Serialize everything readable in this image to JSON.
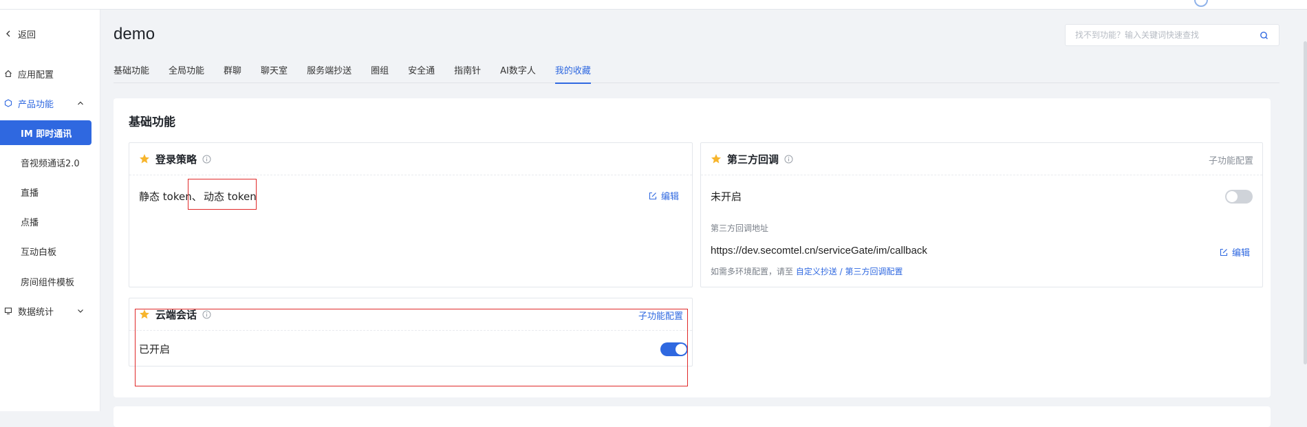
{
  "colors": {
    "primary": "#2f68e0",
    "star": "#f7b52c",
    "highlight": "#e02828"
  },
  "sidebar": {
    "back_label": "返回",
    "items": [
      {
        "label": "应用配置",
        "icon": "home-icon"
      },
      {
        "label": "产品功能",
        "icon": "hexagon-icon",
        "expanded": true
      },
      {
        "label": "数据统计",
        "icon": "monitor-icon",
        "expanded": false
      }
    ],
    "sub_items": [
      {
        "label": "IM 即时通讯",
        "active": true
      },
      {
        "label": "音视频通话2.0"
      },
      {
        "label": "直播"
      },
      {
        "label": "点播"
      },
      {
        "label": "互动白板"
      },
      {
        "label": "房间组件模板"
      }
    ]
  },
  "header": {
    "title": "demo",
    "search_placeholder": "找不到功能？输入关键词快速查找"
  },
  "tabs": [
    {
      "label": "基础功能"
    },
    {
      "label": "全局功能"
    },
    {
      "label": "群聊"
    },
    {
      "label": "聊天室"
    },
    {
      "label": "服务端抄送"
    },
    {
      "label": "圈组"
    },
    {
      "label": "安全通"
    },
    {
      "label": "指南针"
    },
    {
      "label": "AI数字人"
    },
    {
      "label": "我的收藏",
      "active": true
    }
  ],
  "section": {
    "title": "基础功能",
    "login_card": {
      "title": "登录策略",
      "value_static": "静态 token、",
      "value_dynamic": "动态 token",
      "edit_label": "编辑"
    },
    "callback_card": {
      "title": "第三方回调",
      "sub_config_label": "子功能配置",
      "status": "未开启",
      "toggle_on": false,
      "address_label": "第三方回调地址",
      "url": "https://dev.secomtel.cn/serviceGate/im/callback",
      "edit_label": "编辑",
      "hint_prefix": "如需多环境配置，请至",
      "hint_link": "自定义抄送 / 第三方回调配置"
    },
    "cloud_card": {
      "title": "云端会话",
      "sub_config_label": "子功能配置",
      "status": "已开启",
      "toggle_on": true
    }
  }
}
